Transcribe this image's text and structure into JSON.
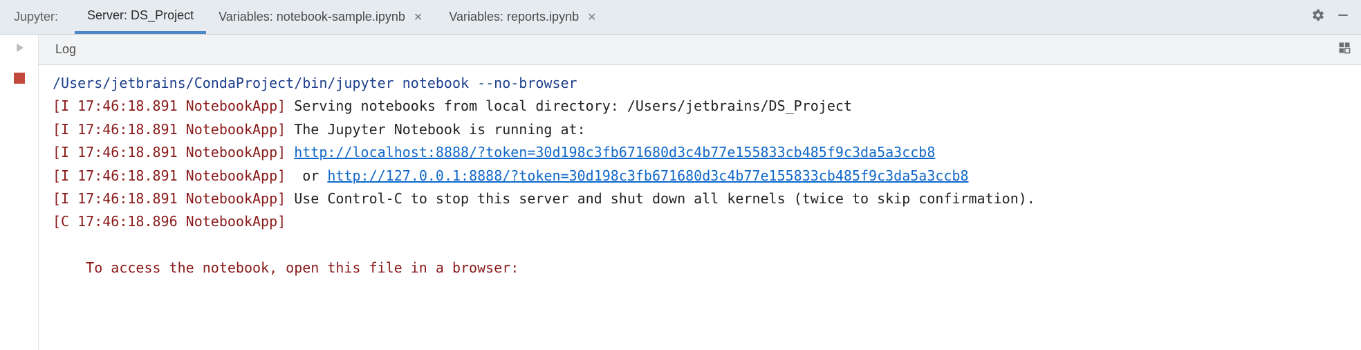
{
  "header": {
    "title": "Jupyter:",
    "tabs": [
      {
        "label": "Server: DS_Project",
        "closable": false,
        "active": true
      },
      {
        "label": "Variables: notebook-sample.ipynb",
        "closable": true,
        "active": false
      },
      {
        "label": "Variables: reports.ipynb",
        "closable": true,
        "active": false
      }
    ]
  },
  "log": {
    "title": "Log",
    "command": "/Users/jetbrains/CondaProject/bin/jupyter notebook --no-browser",
    "lines": [
      {
        "stamp": "[I 17:46:18.891 NotebookApp]",
        "pre": " Serving notebooks from local directory: /Users/jetbrains/DS_Project"
      },
      {
        "stamp": "[I 17:46:18.891 NotebookApp]",
        "pre": " The Jupyter Notebook is running at:"
      },
      {
        "stamp": "[I 17:46:18.891 NotebookApp]",
        "pre": " ",
        "link": "http://localhost:8888/?token=30d198c3fb671680d3c4b77e155833cb485f9c3da5a3ccb8"
      },
      {
        "stamp": "[I 17:46:18.891 NotebookApp]",
        "pre": "  or ",
        "link": "http://127.0.0.1:8888/?token=30d198c3fb671680d3c4b77e155833cb485f9c3da5a3ccb8"
      },
      {
        "stamp": "[I 17:46:18.891 NotebookApp]",
        "pre": " Use Control-C to stop this server and shut down all kernels (twice to skip confirmation)."
      },
      {
        "stamp": "[C 17:46:18.896 NotebookApp]",
        "pre": ""
      }
    ],
    "footer": "    To access the notebook, open this file in a browser:"
  }
}
